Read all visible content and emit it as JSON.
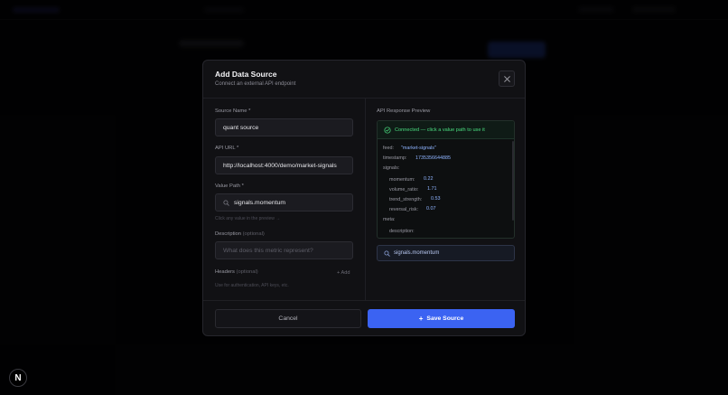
{
  "modal": {
    "title": "Add Data Source",
    "subtitle": "Connect an external API endpoint"
  },
  "form": {
    "source_name": {
      "label": "Source Name",
      "required_mark": "*",
      "value": "quant source"
    },
    "api_url": {
      "label": "API URL",
      "required_mark": "*",
      "value": "http://localhost:4000/demo/market-signals"
    },
    "value_path": {
      "label": "Value Path",
      "required_mark": "*",
      "value": "signals.momentum",
      "hint": "Click any value in the preview →"
    },
    "description": {
      "label": "Description",
      "optional_mark": "(optional)",
      "placeholder": "What does this metric represent?"
    },
    "headers": {
      "label": "Headers",
      "optional_mark": "(optional)",
      "add_label": "+ Add",
      "hint": "Use for authentication, API keys, etc."
    }
  },
  "preview": {
    "title": "API Response Preview",
    "status": "Connected — click a value path to use it",
    "status_color": "#4ade80",
    "json": {
      "feed_key": "feed:",
      "feed_val": "\"market-signals\"",
      "timestamp_key": "timestamp:",
      "timestamp_val": "1735356644885",
      "signals_key": "signals:",
      "momentum_key": "momentum:",
      "momentum_val": "0.22",
      "volume_ratio_key": "volume_ratio:",
      "volume_ratio_val": "1.71",
      "trend_strength_key": "trend_strength:",
      "trend_strength_val": "0.53",
      "reversal_risk_key": "reversal_risk:",
      "reversal_risk_val": "0.07",
      "meta_key": "meta:",
      "description_key": "description:"
    },
    "selected_path": "signals.momentum"
  },
  "footer": {
    "cancel_label": "Cancel",
    "save_label": "Save Source",
    "accent": "#3b63f2"
  },
  "badge": {
    "letter": "N"
  }
}
